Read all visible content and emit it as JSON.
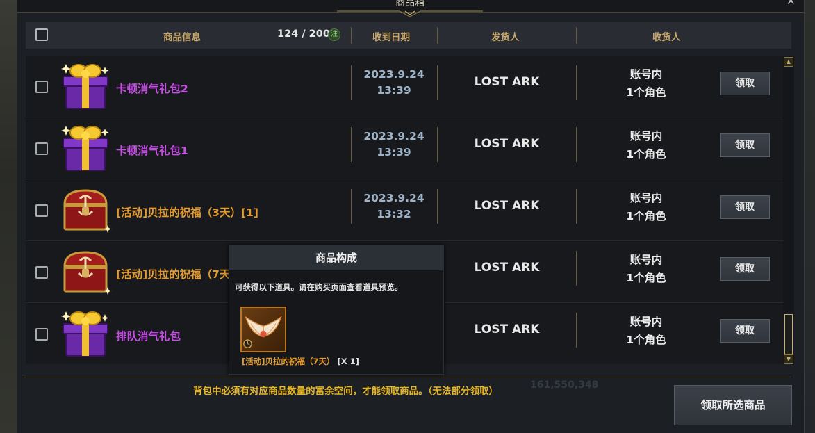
{
  "window": {
    "title": "商品箱",
    "close_icon": "close-icon"
  },
  "header": {
    "col_item": "商品信息",
    "count": "124 / 200",
    "note": "注",
    "col_date": "收到日期",
    "col_sender": "发货人",
    "col_receiver": "收货人"
  },
  "rows": [
    {
      "icon": "gift-box-icon",
      "name": "卡顿消气礼包2",
      "name_color": "purple",
      "date": "2023.9.24",
      "time": "13:39",
      "sender": "LOST ARK",
      "recv1": "账号内",
      "recv2": "1个角色",
      "button": "领取"
    },
    {
      "icon": "gift-box-icon",
      "name": "卡顿消气礼包1",
      "name_color": "purple",
      "date": "2023.9.24",
      "time": "13:39",
      "sender": "LOST ARK",
      "recv1": "账号内",
      "recv2": "1个角色",
      "button": "领取"
    },
    {
      "icon": "treasure-chest-icon",
      "name": "[活动]贝拉的祝福（3天）[1]",
      "name_color": "orange",
      "date": "2023.9.24",
      "time": "13:32",
      "sender": "LOST ARK",
      "recv1": "账号内",
      "recv2": "1个角色",
      "button": "领取"
    },
    {
      "icon": "treasure-chest-icon",
      "name": "[活动]贝拉的祝福（7天",
      "name_color": "orange",
      "date": "",
      "time": "",
      "sender": "LOST ARK",
      "recv1": "账号内",
      "recv2": "1个角色",
      "button": "领取"
    },
    {
      "icon": "gift-box-icon",
      "name": "排队消气礼包",
      "name_color": "purple",
      "date": "",
      "time": "",
      "sender": "LOST ARK",
      "recv1": "账号内",
      "recv2": "1个角色",
      "button": "领取"
    }
  ],
  "footer": {
    "notice": "背包中必须有对应商品数量的富余空间，才能领取商品。（无法部分领取）",
    "claim_selected": "领取所选商品"
  },
  "tooltip": {
    "title": "商品构成",
    "description": "可获得以下道具。请在购买页面查看道具预览。",
    "item_icon": "wings-icon",
    "item_name": "[活动]贝拉的祝福（7天）",
    "item_qty": "[X 1]"
  },
  "background_text": {
    "gold_amount": "161,550,348"
  },
  "colors": {
    "gold": "#c9a86b",
    "purple": "#c64fe6",
    "orange": "#e49b2c",
    "notice": "#e8b726"
  }
}
